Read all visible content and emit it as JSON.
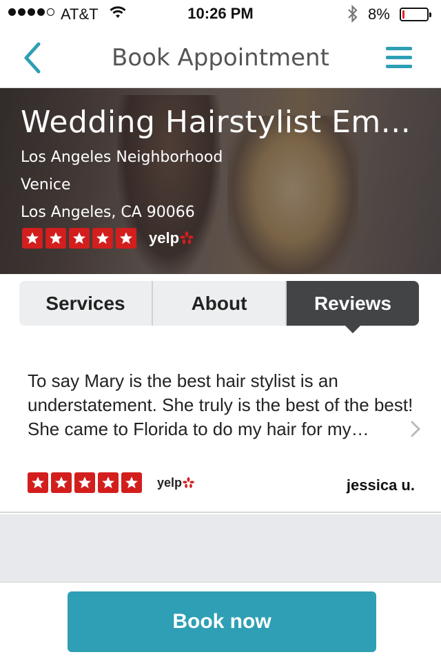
{
  "status_bar": {
    "carrier": "AT&T",
    "time": "10:26 PM",
    "battery_percent": "8%",
    "battery_level": 0.08,
    "signal_bars_filled": 4,
    "signal_bars_total": 5
  },
  "nav": {
    "title": "Book Appointment",
    "back_icon": "chevron-left-icon",
    "menu_icon": "hamburger-menu-icon",
    "accent_color": "#2e9fb5"
  },
  "business": {
    "name": "Wedding Hairstylist Em...",
    "neighborhood": "Los Angeles Neighborhood",
    "area": "Venice",
    "city_line": "Los Angeles, CA 90066",
    "rating_stars": 5,
    "rating_source": "yelp"
  },
  "tabs": [
    {
      "label": "Services",
      "active": false
    },
    {
      "label": "About",
      "active": false
    },
    {
      "label": "Reviews",
      "active": true
    }
  ],
  "review": {
    "text": "To say Mary is the best hair stylist is an understatement. She truly is the best of the best! She came to Florida to do my hair for my wedding and it was amazing.",
    "rating_stars": 5,
    "source": "yelp",
    "author": "jessica u."
  },
  "footer": {
    "book_label": "Book now"
  },
  "colors": {
    "star_red": "#d31e1e",
    "active_tab": "#424446",
    "button": "#2e9fb5"
  }
}
